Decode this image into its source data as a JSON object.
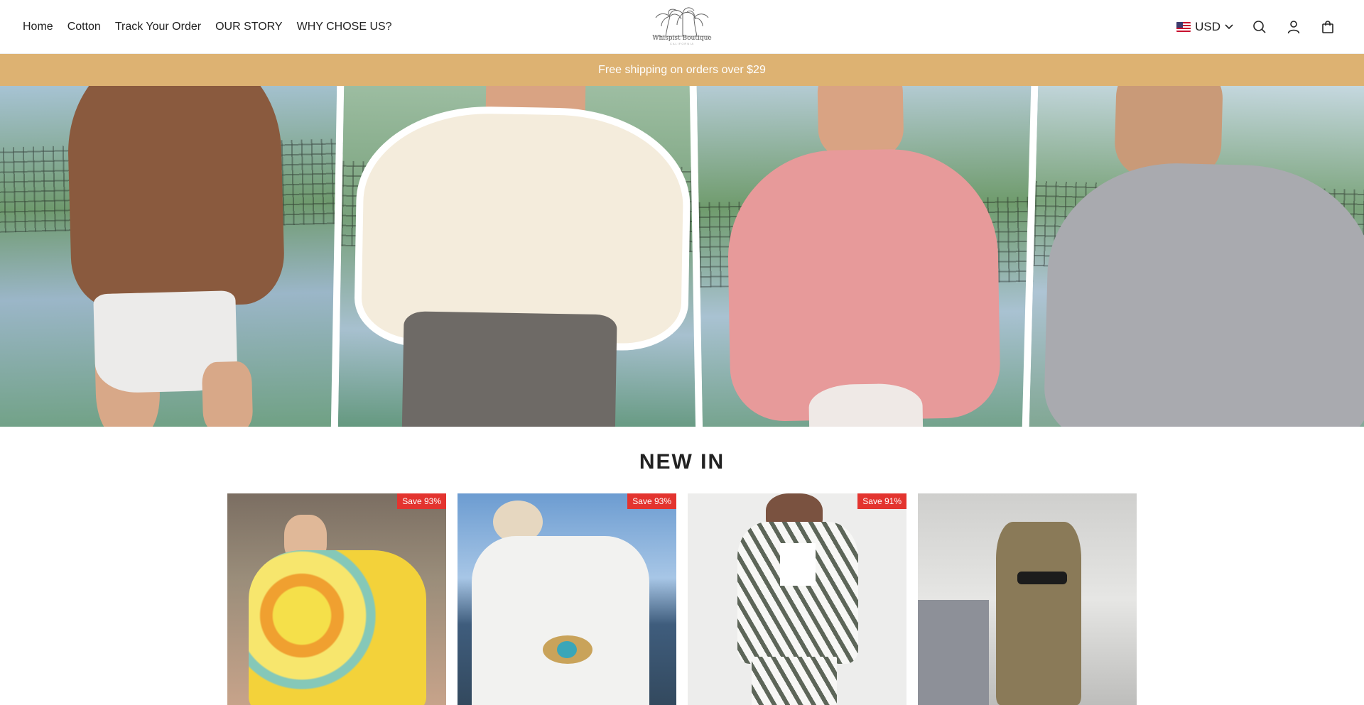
{
  "header": {
    "nav": [
      "Home",
      "Cotton",
      "Track Your Order",
      "OUR STORY",
      "WHY CHOSE US?"
    ],
    "logo_text": "Whispist Boutique",
    "logo_sub": "CALIFORNIA",
    "currency": "USD",
    "icons": [
      "search-icon",
      "account-icon",
      "cart-icon",
      "chevron-down-icon"
    ]
  },
  "announcement": {
    "text": "Free shipping on orders over $29"
  },
  "section": {
    "title": "NEW IN"
  },
  "products": [
    {
      "badge": "Save 93%"
    },
    {
      "badge": "Save 93%"
    },
    {
      "badge": "Save 91%"
    },
    {
      "badge": ""
    }
  ],
  "colors": {
    "announcement_bg": "#ddb272",
    "badge_bg": "#e3342f"
  }
}
